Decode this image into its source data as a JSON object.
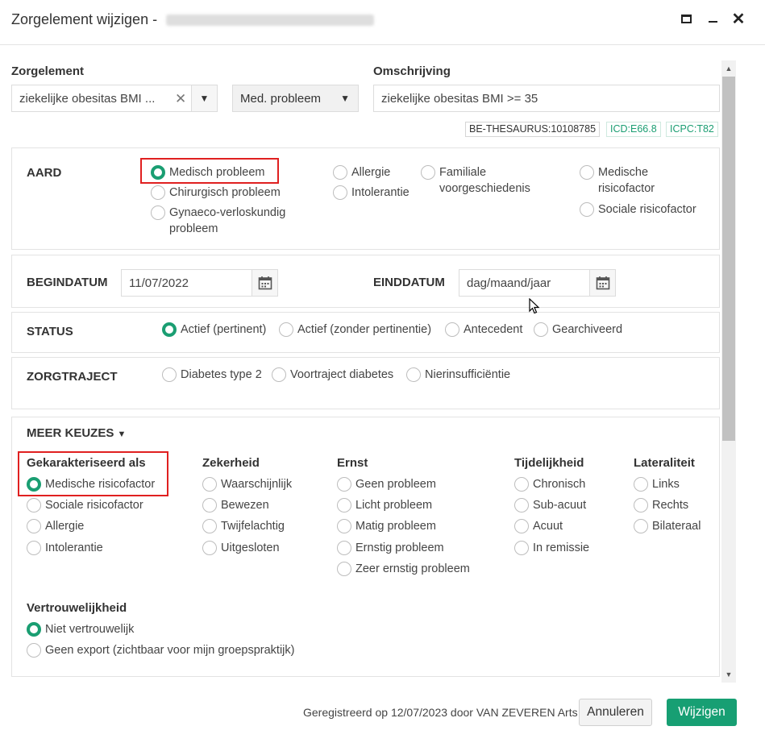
{
  "window": {
    "title": "Zorgelement wijzigen - ",
    "maximize_icon": "maximize-icon",
    "minimize_icon": "minimize-icon",
    "close_glyph": "✕"
  },
  "zorgelement": {
    "label": "Zorgelement",
    "value": "ziekelijke obesitas BMI ...",
    "clear_glyph": "✕",
    "dropdown_glyph": "▼",
    "type_value": "Med. probleem"
  },
  "omschrijving": {
    "label": "Omschrijving",
    "value": "ziekelijke obesitas BMI >= 35"
  },
  "codes": [
    "BE-THESAURUS:10108785",
    "ICD:E66.8",
    "ICPC:T82"
  ],
  "aard": {
    "title": "AARD",
    "options": [
      "Medisch probleem",
      "Chirurgisch probleem",
      "Gynaeco-verloskundig probleem",
      "Allergie",
      "Intolerantie",
      "Familiale voorgeschiedenis",
      "Medische risicofactor",
      "Sociale risicofactor"
    ],
    "selected": "Medisch probleem"
  },
  "dates": {
    "begin_label": "BEGINDATUM",
    "begin_value": "11/07/2022",
    "end_label": "EINDDATUM",
    "end_placeholder": "dag/maand/jaar"
  },
  "status": {
    "title": "STATUS",
    "options": [
      "Actief (pertinent)",
      "Actief (zonder pertinentie)",
      "Antecedent",
      "Gearchiveerd"
    ],
    "selected": "Actief (pertinent)"
  },
  "zorgtraject": {
    "title": "ZORGTRAJECT",
    "options": [
      "Diabetes type 2",
      "Voortraject diabetes",
      "Nierinsufficiëntie"
    ]
  },
  "meer_keuzes": {
    "title": "MEER KEUZES",
    "toggle_glyph": "▼",
    "gekarakteriseerd": {
      "title": "Gekarakteriseerd als",
      "options": [
        "Medische risicofactor",
        "Sociale risicofactor",
        "Allergie",
        "Intolerantie"
      ],
      "selected": "Medische risicofactor"
    },
    "zekerheid": {
      "title": "Zekerheid",
      "options": [
        "Waarschijnlijk",
        "Bewezen",
        "Twijfelachtig",
        "Uitgesloten"
      ]
    },
    "ernst": {
      "title": "Ernst",
      "options": [
        "Geen probleem",
        "Licht probleem",
        "Matig probleem",
        "Ernstig probleem",
        "Zeer ernstig probleem"
      ]
    },
    "tijdelijkheid": {
      "title": "Tijdelijkheid",
      "options": [
        "Chronisch",
        "Sub-acuut",
        "Acuut",
        "In remissie"
      ]
    },
    "lateraliteit": {
      "title": "Lateraliteit",
      "options": [
        "Links",
        "Rechts",
        "Bilateraal"
      ]
    },
    "vertrouwelijkheid": {
      "title": "Vertrouwelijkheid",
      "options": [
        "Niet vertrouwelijk",
        "Geen export (zichtbaar voor mijn groepspraktijk)"
      ],
      "selected": "Niet vertrouwelijk"
    }
  },
  "footer": {
    "registered": "Geregistreerd op 12/07/2023 door VAN ZEVEREN Arts",
    "cancel": "Annuleren",
    "submit": "Wijzigen"
  },
  "scroll_glyphs": {
    "up": "▲",
    "down": "▼"
  },
  "colors": {
    "accent": "#1a9e72",
    "highlight": "#e02020",
    "code_green": "#1a9e72"
  }
}
